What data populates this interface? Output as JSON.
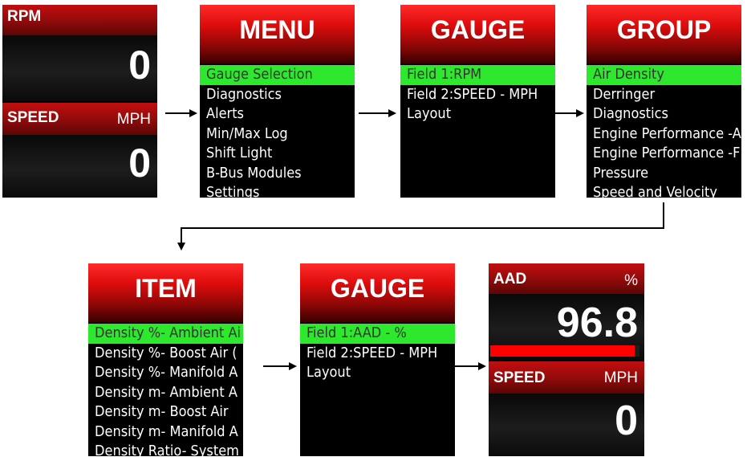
{
  "screen1": {
    "top": {
      "label": "RPM",
      "unit": "",
      "value": "0"
    },
    "bottom": {
      "label": "SPEED",
      "unit": "MPH",
      "value": "0"
    }
  },
  "menu": {
    "title": "MENU",
    "items": [
      "Gauge Selection",
      "Diagnostics",
      "Alerts",
      "Min/Max Log",
      "Shift Light",
      "B-Bus Modules",
      "Settings"
    ],
    "selected": 0
  },
  "gauge1": {
    "title": "GAUGE",
    "items": [
      "Field 1:RPM",
      "Field 2:SPEED - MPH",
      "Layout"
    ],
    "selected": 0
  },
  "group": {
    "title": "GROUP",
    "items": [
      "Air Density",
      "Derringer",
      "Diagnostics",
      "Engine Performance -A",
      "Engine Performance -F",
      "Pressure",
      "Speed and Velocity"
    ],
    "selected": 0
  },
  "item": {
    "title": "ITEM",
    "items": [
      "Density %- Ambient Ai",
      "Density %- Boost Air (",
      "Density %- Manifold A",
      "Density m- Ambient A",
      "Density m- Boost Air",
      "Density m- Manifold A",
      "Density Ratio- System"
    ],
    "selected": 0
  },
  "gauge2": {
    "title": "GAUGE",
    "items": [
      "Field 1:AAD    - %",
      "Field 2:SPEED - MPH",
      "Layout"
    ],
    "selected": 0
  },
  "screen2": {
    "top": {
      "label": "AAD",
      "unit": "%",
      "value": "96.8",
      "fraction": 0.968
    },
    "bottom": {
      "label": "SPEED",
      "unit": "MPH",
      "value": "0"
    }
  },
  "colors": {
    "selection": "#2ee82e",
    "header_red": "#c20e0e",
    "bar_red": "#ff0000"
  }
}
